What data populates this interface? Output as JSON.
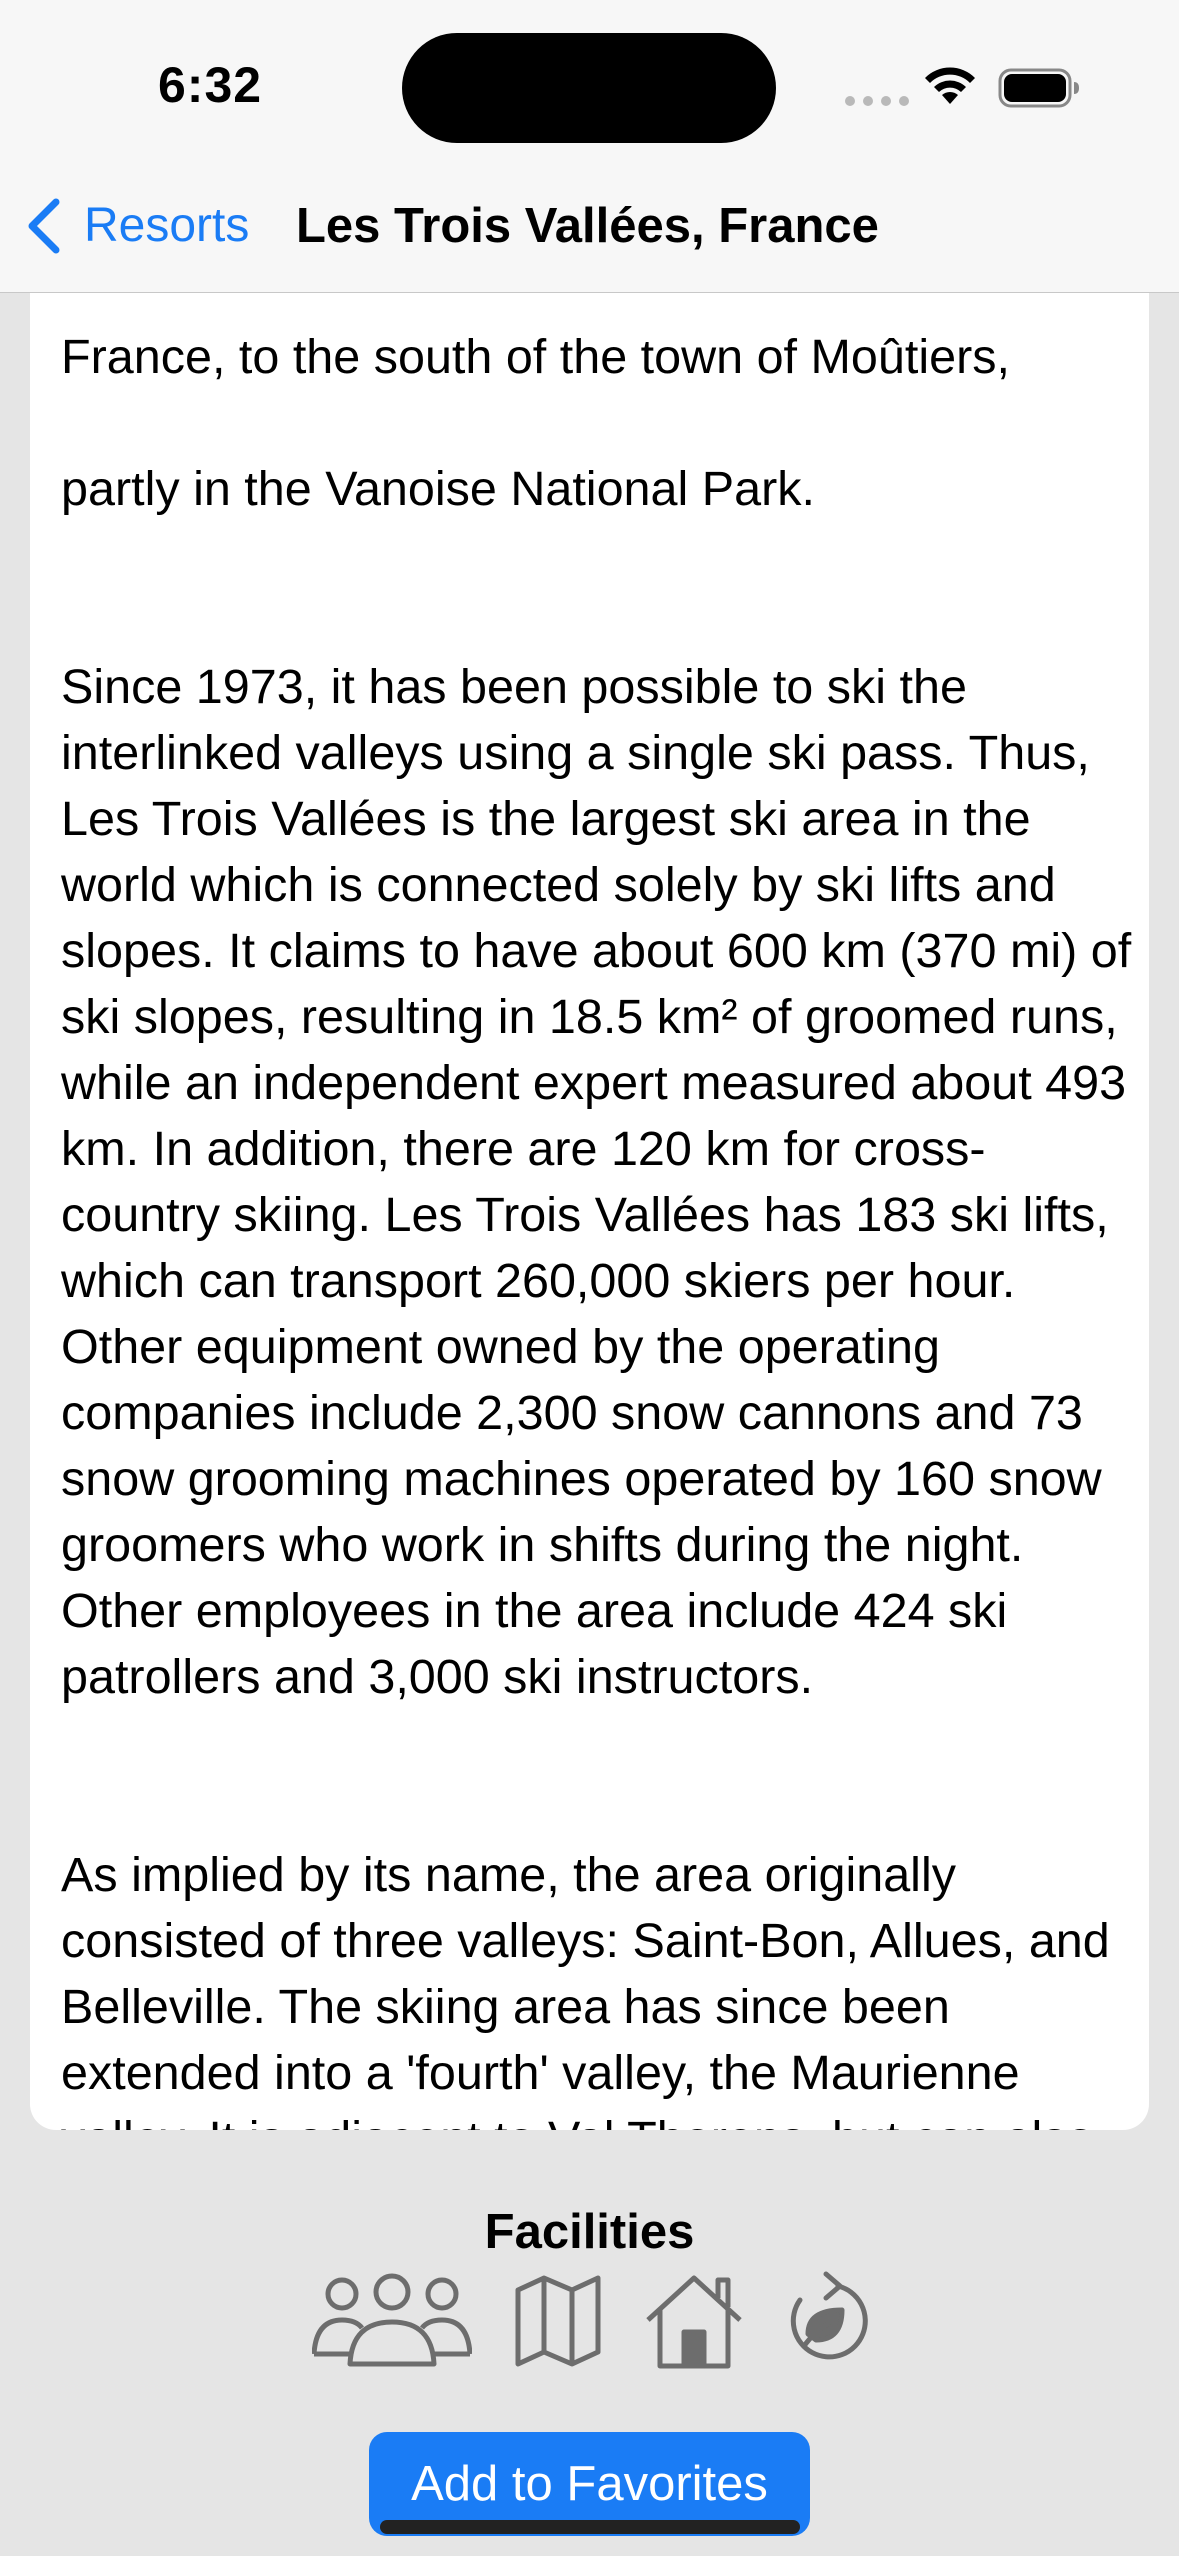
{
  "status_bar": {
    "time": "6:32"
  },
  "nav": {
    "back_label": "Resorts",
    "title": "Les Trois Vallées, France"
  },
  "description": {
    "partial_top_line": "France, to the south of the town of Moûtiers,",
    "paragraphs": [
      "partly in the Vanoise National Park.",
      "Since 1973, it has been possible to ski the interlinked valleys using a single ski pass. Thus, Les Trois Vallées is the largest ski area in the world which is connected solely by ski lifts and slopes. It claims to have about 600 km (370 mi) of ski slopes, resulting in 18.5 km² of groomed runs, while an independent expert measured about 493 km. In addition, there are 120 km for cross-country skiing. Les Trois Vallées has 183 ski lifts, which can transport 260,000 skiers per hour. Other equipment owned by the operating companies include 2,300 snow cannons and 73 snow grooming machines operated by 160 snow groomers who work in shifts during the night. Other employees in the area include 424 ski patrollers and 3,000 ski instructors.",
      "As implied by its name, the area originally consisted of three valleys: Saint-Bon, Allues, and Belleville. The skiing area has since been extended into a 'fourth' valley, the Maurienne valley. It is adjacent to Val Thorens, but can also be accessed using a long gondola lift from Orelle."
    ]
  },
  "facilities": {
    "title": "Facilities",
    "icons": [
      "people-icon",
      "map-icon",
      "house-icon",
      "eco-recycle-icon"
    ]
  },
  "favorite_button": {
    "label": "Add to Favorites"
  },
  "colors": {
    "accent": "#1a7cf5",
    "background": "#e5e5e5",
    "card": "#ffffff",
    "icon_gray": "#6d6d6d"
  }
}
